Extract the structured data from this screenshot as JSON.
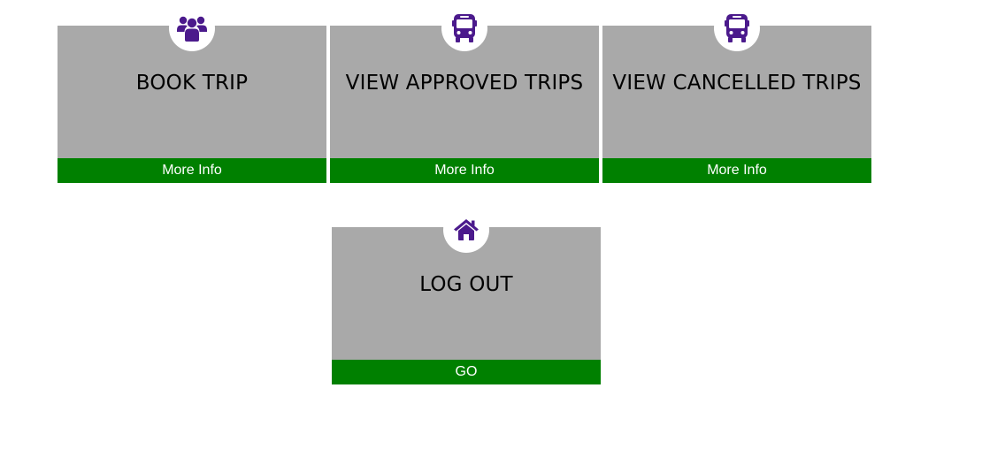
{
  "colors": {
    "card_bg": "#a9a9a9",
    "button_bg": "#008000",
    "icon": "#4b1a8c"
  },
  "cards": [
    {
      "title": "BOOK TRIP",
      "button": "More Info",
      "icon": "users-icon"
    },
    {
      "title": "VIEW APPROVED TRIPS",
      "button": "More Info",
      "icon": "bus-icon"
    },
    {
      "title": "VIEW CANCELLED TRIPS",
      "button": "More Info",
      "icon": "bus-icon"
    },
    {
      "title": "LOG OUT",
      "button": "GO",
      "icon": "home-icon"
    }
  ]
}
